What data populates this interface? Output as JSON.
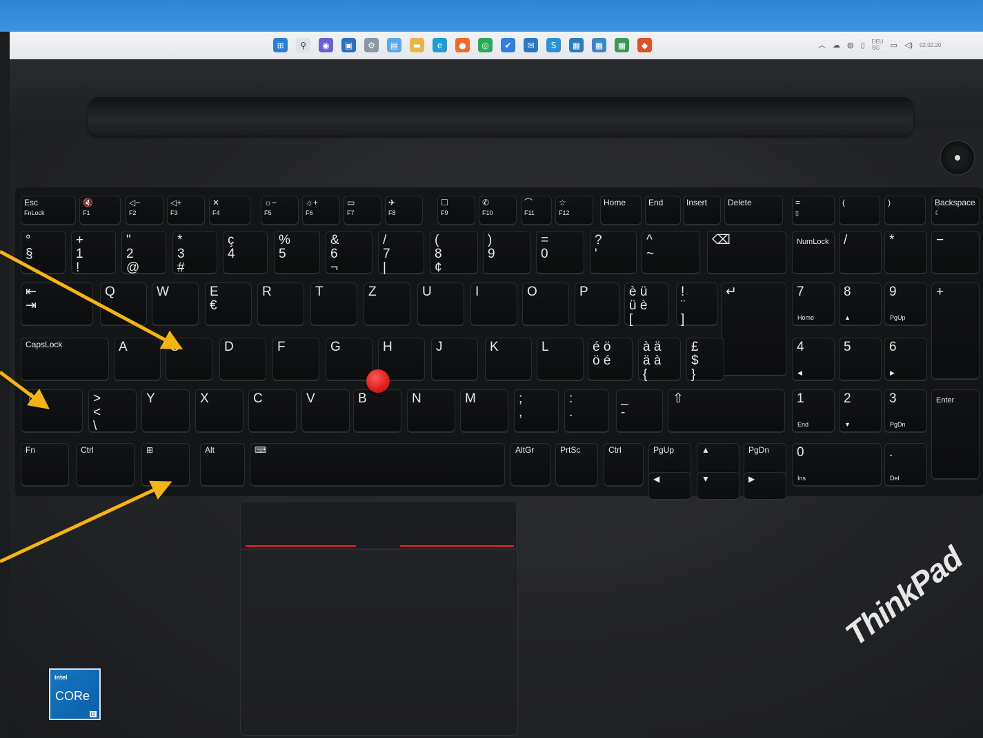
{
  "taskbar": {
    "icons": [
      "windows-start-icon",
      "search-icon",
      "chat-icon",
      "store-icon",
      "settings-icon",
      "photos-icon",
      "explorer-icon",
      "edge-icon",
      "firefox-icon",
      "chrome-icon",
      "todo-icon",
      "mail-icon",
      "skype-icon",
      "app1-icon",
      "app2-icon",
      "app3-icon",
      "office-icon"
    ],
    "tray_lang": "DEU",
    "tray_lang_sub": "SG",
    "tray_date": "02.02.20",
    "colors": {
      "screen": "#3a8ddc",
      "taskbar": "#eceef1"
    }
  },
  "keyboard": {
    "function_row": [
      {
        "main": "Esc",
        "sub": "FnLock"
      },
      {
        "main": "🔇",
        "sub": "F1"
      },
      {
        "main": "◁−",
        "sub": "F2"
      },
      {
        "main": "◁+",
        "sub": "F3"
      },
      {
        "main": "✕",
        "sub": "F4"
      },
      {
        "main": "☼−",
        "sub": "F5"
      },
      {
        "main": "☼+",
        "sub": "F6"
      },
      {
        "main": "▭",
        "sub": "F7"
      },
      {
        "main": "✈",
        "sub": "F8"
      },
      {
        "main": "☐",
        "sub": "F9"
      },
      {
        "main": "✆",
        "sub": "F10"
      },
      {
        "main": "⌒",
        "sub": "F11"
      },
      {
        "main": "☆",
        "sub": "F12"
      },
      {
        "main": "Home",
        "sub": ""
      },
      {
        "main": "End",
        "sub": ""
      },
      {
        "main": "Insert",
        "sub": ""
      },
      {
        "main": "Delete",
        "sub": ""
      },
      {
        "main": "=",
        "sub": "▯"
      },
      {
        "main": "(",
        "sub": ""
      },
      {
        "main": ")",
        "sub": ""
      },
      {
        "main": "Backspace",
        "sub": "☾"
      }
    ],
    "number_row": [
      "°\n§",
      "+\n1\n!",
      "\"\n2\n@",
      "*\n3\n#",
      "ç\n4",
      "%\n5",
      "&\n6\n¬",
      "/\n7\n|",
      "(\n8\n¢",
      ")\n9",
      "=\n0",
      "?\n'",
      "^\n~",
      "⌫"
    ],
    "qwertz_row": [
      "⇤\n⇥",
      "Q",
      "W",
      "E\n€",
      "R",
      "T",
      "Z",
      "U",
      "I",
      "O",
      "P",
      "è ü\nü è\n[",
      "!\n¨\n]",
      "↵"
    ],
    "home_row": [
      "CapsLock",
      "A",
      "S",
      "D",
      "F",
      "G",
      "H",
      "J",
      "K",
      "L",
      "é ö\nö é",
      "à ä\nä à\n{",
      "£\n$\n}"
    ],
    "shift_row": [
      "⇧",
      ">\n<\n\\",
      "Y",
      "X",
      "C",
      "V",
      "B",
      "N",
      "M",
      ";\n,",
      ":\n.",
      "_\n-",
      "⇧"
    ],
    "bottom_row": [
      "Fn",
      "Ctrl",
      "⊞",
      "Alt",
      "⌨",
      "AltGr",
      "PrtSc",
      "Ctrl",
      "PgUp",
      "▲",
      "PgDn"
    ],
    "arrow_row": [
      "◀",
      "▼",
      "▶"
    ],
    "numpad": [
      {
        "main": "NumLock",
        "sub": ""
      },
      {
        "main": "/",
        "sub": ""
      },
      {
        "main": "*",
        "sub": ""
      },
      {
        "main": "−",
        "sub": ""
      },
      {
        "main": "7",
        "sub": "Home"
      },
      {
        "main": "8",
        "sub": "▲"
      },
      {
        "main": "9",
        "sub": "PgUp"
      },
      {
        "main": "+",
        "sub": ""
      },
      {
        "main": "4",
        "sub": "◀"
      },
      {
        "main": "5",
        "sub": ""
      },
      {
        "main": "6",
        "sub": "▶"
      },
      {
        "main": "1",
        "sub": "End"
      },
      {
        "main": "2",
        "sub": "▼"
      },
      {
        "main": "3",
        "sub": "PgDn"
      },
      {
        "main": "Enter",
        "sub": ""
      },
      {
        "main": "0",
        "sub": "Ins"
      },
      {
        "main": ".",
        "sub": "Del"
      }
    ]
  },
  "stickers": {
    "intel_line1": "intel",
    "intel_line2": "CORe",
    "intel_line3": "i3"
  },
  "logo": {
    "brand": "ThinkPad",
    "accent": "#e3211f"
  },
  "annotations": {
    "arrow_color": "#f5b40f",
    "arrow_targets": [
      "S-key",
      "Shift-key",
      "Windows-key"
    ]
  }
}
